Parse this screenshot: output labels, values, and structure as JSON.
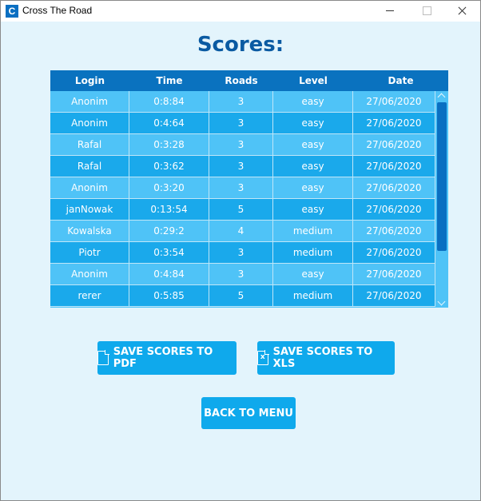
{
  "window": {
    "title": "Cross The Road",
    "icon_letter": "C"
  },
  "heading": "Scores:",
  "table": {
    "columns": [
      "Login",
      "Time",
      "Roads",
      "Level",
      "Date"
    ],
    "rows": [
      [
        "Anonim",
        "0:8:84",
        "3",
        "easy",
        "27/06/2020"
      ],
      [
        "Anonim",
        "0:4:64",
        "3",
        "easy",
        "27/06/2020"
      ],
      [
        "Rafal",
        "0:3:28",
        "3",
        "easy",
        "27/06/2020"
      ],
      [
        "Rafal",
        "0:3:62",
        "3",
        "easy",
        "27/06/2020"
      ],
      [
        "Anonim",
        "0:3:20",
        "3",
        "easy",
        "27/06/2020"
      ],
      [
        "janNowak",
        "0:13:54",
        "5",
        "easy",
        "27/06/2020"
      ],
      [
        "Kowalska",
        "0:29:2",
        "4",
        "medium",
        "27/06/2020"
      ],
      [
        "Piotr",
        "0:3:54",
        "3",
        "medium",
        "27/06/2020"
      ],
      [
        "Anonim",
        "0:4:84",
        "3",
        "easy",
        "27/06/2020"
      ],
      [
        "rerer",
        "0:5:85",
        "5",
        "medium",
        "27/06/2020"
      ]
    ]
  },
  "buttons": {
    "save_pdf": "SAVE SCORES TO PDF",
    "save_xls": "SAVE SCORES TO XLS",
    "back": "BACK TO MENU"
  },
  "colors": {
    "background": "#e3f4fc",
    "heading": "#0a5aa2",
    "table_header": "#0a72bf",
    "row_light": "#4fc3f7",
    "row_dark": "#1aa9eb",
    "button": "#0fa9ec"
  }
}
